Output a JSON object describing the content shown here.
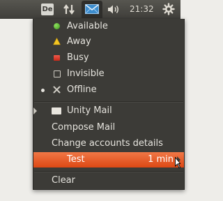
{
  "panel": {
    "keyboard_label": "De",
    "network_icon": "network-arrows-icon",
    "mail_icon": "envelope-icon",
    "volume_icon": "speaker-icon",
    "clock": "21:32",
    "system_icon": "gear-icon"
  },
  "menu": {
    "status_items": [
      {
        "label": "Available",
        "icon": "green-dot-icon"
      },
      {
        "label": "Away",
        "icon": "yellow-triangle-icon"
      },
      {
        "label": "Busy",
        "icon": "red-square-icon"
      },
      {
        "label": "Invisible",
        "icon": "empty-square-icon"
      },
      {
        "label": "Offline",
        "icon": "x-icon",
        "selected": true
      }
    ],
    "app_label": "Unity Mail",
    "compose_label": "Compose Mail",
    "change_accounts_label": "Change accounts details",
    "message": {
      "label": "Test",
      "time": "1 min"
    },
    "clear_label": "Clear"
  },
  "colors": {
    "panel": "#3f3e3a",
    "menu_bg": "#3c3b37",
    "highlight": "#dd4814",
    "mail_blue": "#3c8ccd"
  }
}
